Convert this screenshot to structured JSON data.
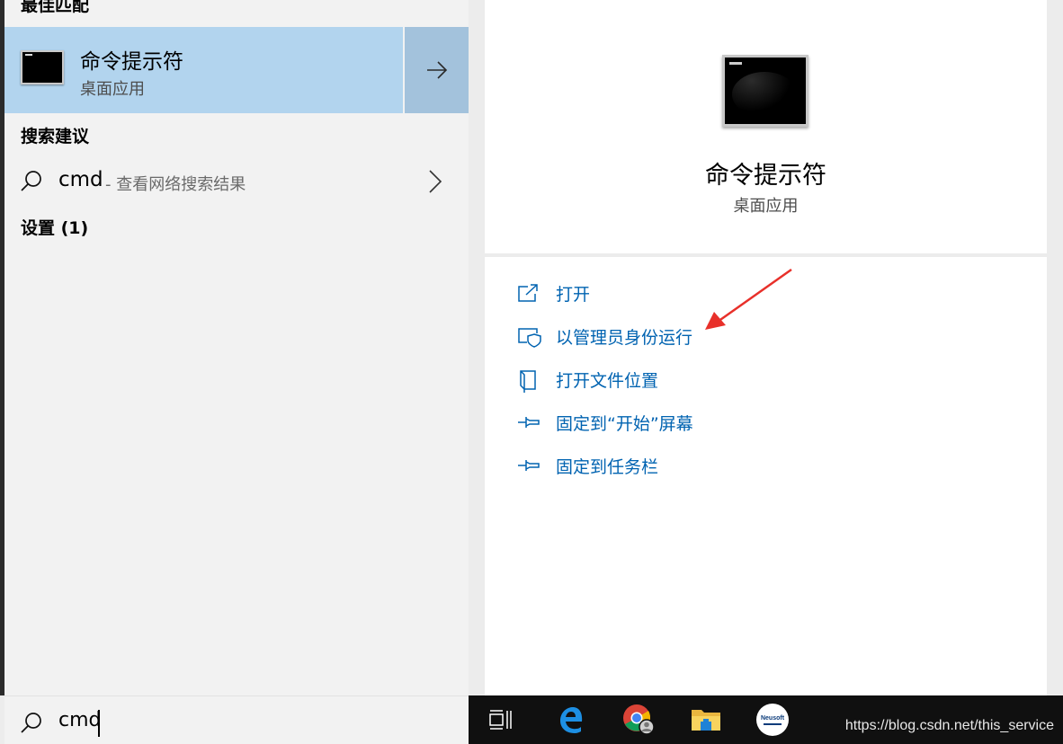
{
  "best_match": {
    "header": "最佳匹配",
    "title": "命令提示符",
    "subtitle": "桌面应用"
  },
  "suggestions": {
    "header": "搜索建议",
    "query": "cmd",
    "hint": "- 查看网络搜索结果"
  },
  "settings": {
    "header": "设置 (1)"
  },
  "detail": {
    "title": "命令提示符",
    "subtitle": "桌面应用",
    "actions": [
      {
        "label": "打开",
        "icon": "open-icon"
      },
      {
        "label": "以管理员身份运行",
        "icon": "shield-admin-icon"
      },
      {
        "label": "打开文件位置",
        "icon": "file-location-icon"
      },
      {
        "label": "固定到“开始”屏幕",
        "icon": "pin-icon"
      },
      {
        "label": "固定到任务栏",
        "icon": "pin-icon"
      }
    ]
  },
  "search_box": {
    "value": "cmd"
  },
  "taskbar": {
    "items": [
      "task-view-icon",
      "edge-browser-icon",
      "chrome-icon",
      "file-explorer-icon",
      "neusoft-app-icon"
    ],
    "neusoft_text": "Neusoft"
  },
  "watermark": "https://blog.csdn.net/this_service",
  "colors": {
    "selected_row": "#b2d4ee",
    "arrow_tile": "#a3c2dc",
    "action_text": "#0063b1",
    "annotation_arrow": "#e8302a",
    "taskbar": "#101010"
  }
}
